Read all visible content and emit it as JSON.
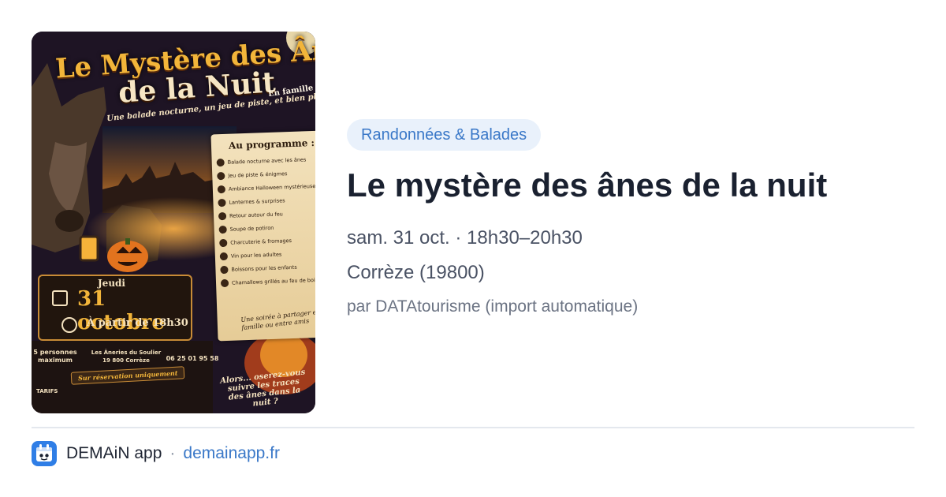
{
  "event": {
    "category": "Randonnées & Balades",
    "title": "Le mystère des ânes de la nuit",
    "when": "sam. 31 oct. · 18h30–20h30",
    "where": "Corrèze (19800)",
    "source": "par DATAtourisme (import automatique)"
  },
  "poster": {
    "title_line1": "Le Mystère des Ânes",
    "title_line2": "de la Nuit",
    "subtitle": "Une balade nocturne, un jeu de piste, et bien plus encore...",
    "family_tag": "En famille ou entre amis",
    "program_title": "Au programme :",
    "program_items": [
      "Balade nocturne avec les ânes",
      "Jeu de piste & énigmes",
      "Ambiance Halloween mystérieuse",
      "Lanternes & surprises",
      "Retour autour du feu",
      "Soupe de potiron",
      "Charcuterie & fromages",
      "Vin pour les adultes",
      "Boissons pour les enfants",
      "Chamallows grillés au feu de bois"
    ],
    "program_footer": "Une soirée à partager en famille ou entre amis",
    "day": "Jeudi",
    "date": "31 octobre",
    "hour": "À partir de 18h30",
    "people": "5 personnes maximum",
    "place": "Les Âneries du Soulier 19 800 Corrèze",
    "phone": "06 25 01 95 58",
    "reservation": "Sur réservation uniquement",
    "tarifs": "TARIFS",
    "closing": "Alors... oserez-vous suivre les traces des ânes dans la nuit ?"
  },
  "footer": {
    "app_name": "DEMAiN app",
    "separator": "·",
    "domain": "demainapp.fr"
  },
  "colors": {
    "badge_bg": "#e9f1fb",
    "badge_text": "#3a78c8",
    "link": "#3a78c8",
    "app_icon": "#2f7ee6"
  },
  "icons": [
    "app-logo-icon",
    "calendar-icon",
    "clock-icon",
    "pumpkin-icon",
    "lantern-icon"
  ]
}
